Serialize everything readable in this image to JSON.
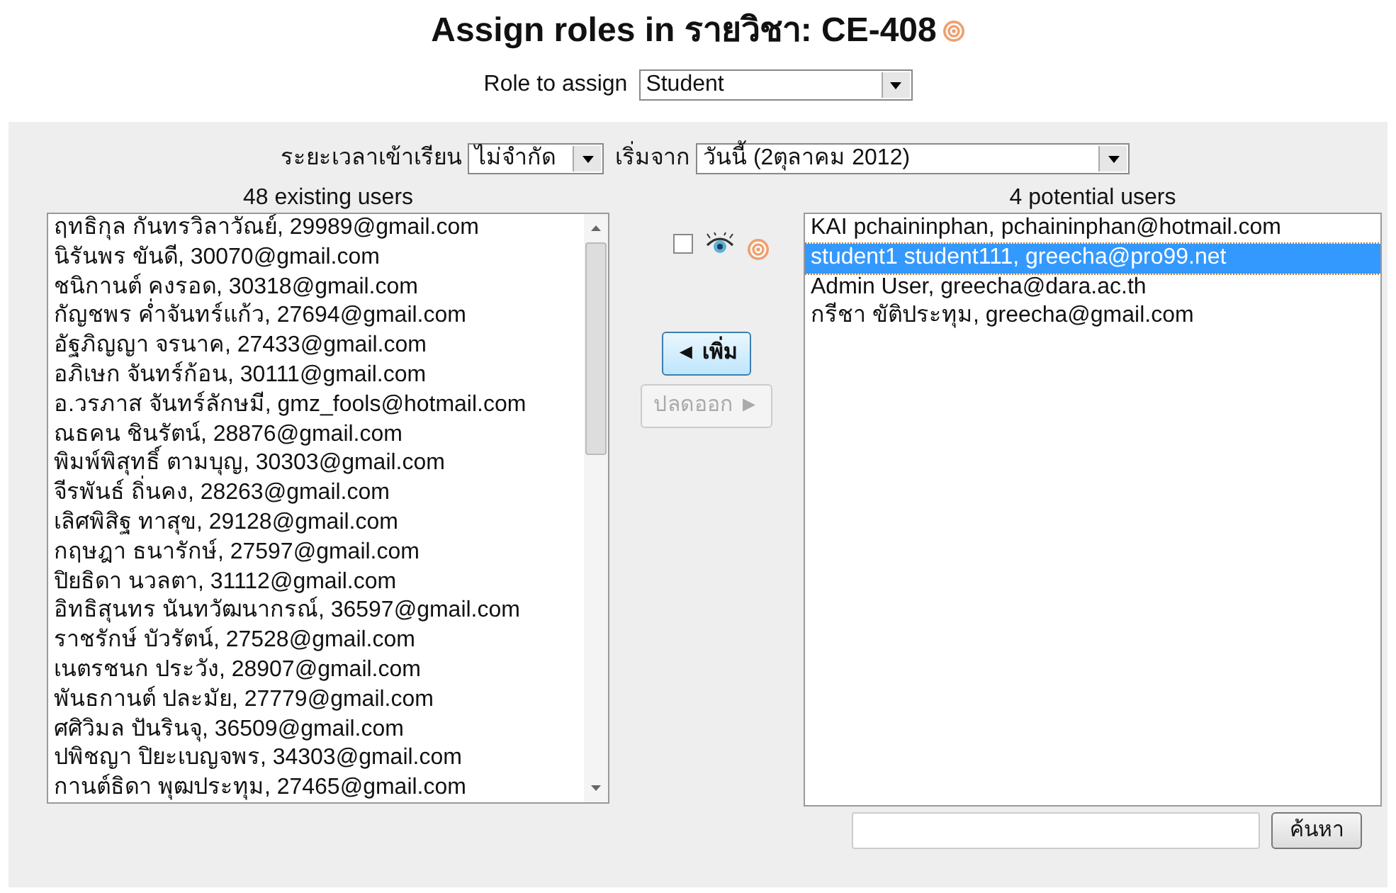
{
  "title": "Assign roles in รายวิชา: CE-408",
  "role_select": {
    "label": "Role to assign",
    "value": "Student"
  },
  "enrolment": {
    "duration_label": "ระยะเวลาเข้าเรียน",
    "duration_value": "ไม่จำกัด",
    "start_label": "เริ่มจาก",
    "start_value": "วันนี้ (2ตุลาคม 2012)"
  },
  "existing_users": {
    "heading": "48 existing users",
    "items": [
      {
        "text": "ฤทธิกุล กันทรวิลาวัณย์, 29989@gmail.com",
        "selected": false
      },
      {
        "text": "นิรันพร ขันดี, 30070@gmail.com",
        "selected": false
      },
      {
        "text": "ชนิกานต์ คงรอด, 30318@gmail.com",
        "selected": false
      },
      {
        "text": "กัญชพร ค่ำจันทร์แก้ว, 27694@gmail.com",
        "selected": false
      },
      {
        "text": "อัฐภิญญา จรนาค, 27433@gmail.com",
        "selected": false
      },
      {
        "text": "อภิเษก จันทร์ก้อน, 30111@gmail.com",
        "selected": false
      },
      {
        "text": "อ.วรภาส จันทร์ลักษมี, gmz_fools@hotmail.com",
        "selected": false
      },
      {
        "text": "ณธคน ชินรัตน์, 28876@gmail.com",
        "selected": false
      },
      {
        "text": "พิมพ์พิสุทธิ์ ตามบุญ, 30303@gmail.com",
        "selected": false
      },
      {
        "text": "จีรพันธ์ ถิ่นคง, 28263@gmail.com",
        "selected": false
      },
      {
        "text": "เลิศพิสิฐ ทาสุข, 29128@gmail.com",
        "selected": false
      },
      {
        "text": "กฤษฎา ธนารักษ์, 27597@gmail.com",
        "selected": false
      },
      {
        "text": "ปิยธิดา นวลตา, 31112@gmail.com",
        "selected": false
      },
      {
        "text": "อิทธิสุนทร นันทวัฒนากรณ์, 36597@gmail.com",
        "selected": false
      },
      {
        "text": "ราชรักษ์ บัวรัตน์, 27528@gmail.com",
        "selected": false
      },
      {
        "text": "เนตรชนก ประวัง, 28907@gmail.com",
        "selected": false
      },
      {
        "text": "พันธกานต์ ปละมัย, 27779@gmail.com",
        "selected": false
      },
      {
        "text": "ศศิวิมล ปันรินจุ, 36509@gmail.com",
        "selected": false
      },
      {
        "text": "ปพิชญา ปิยะเบญจพร, 34303@gmail.com",
        "selected": false
      },
      {
        "text": "กานต์ธิดา พุฒประทุม, 27465@gmail.com",
        "selected": false
      }
    ]
  },
  "show_checkbox": {
    "checked": false
  },
  "add_button": {
    "label": "◄ เพิ่ม",
    "disabled": false
  },
  "remove_button": {
    "label": "ปลดออก ►",
    "disabled": true
  },
  "potential_users": {
    "heading": "4 potential users",
    "items": [
      {
        "text": "KAI pchaininphan, pchaininphan@hotmail.com",
        "selected": false
      },
      {
        "text": "student1 student111, greecha@pro99.net",
        "selected": true
      },
      {
        "text": "Admin User, greecha@dara.ac.th",
        "selected": false
      },
      {
        "text": "กรีชา ขัติประทุม, greecha@gmail.com",
        "selected": false
      }
    ]
  },
  "search_button": {
    "label": "ค้นหา"
  }
}
